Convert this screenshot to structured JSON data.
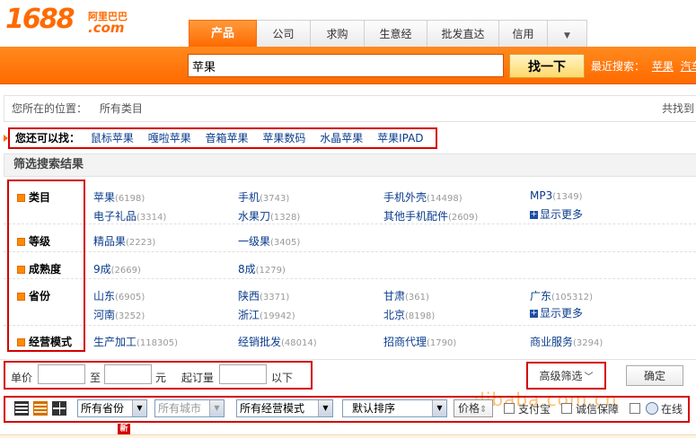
{
  "logo": {
    "number": "1688",
    "brand_cn": "阿里巴巴",
    "domain": ".com"
  },
  "tabs": [
    {
      "label": "产品",
      "active": true
    },
    {
      "label": "公司"
    },
    {
      "label": "求购"
    },
    {
      "label": "生意经"
    },
    {
      "label": "批发直达"
    },
    {
      "label": "信用"
    },
    {
      "label": "▼"
    }
  ],
  "search": {
    "value": "苹果",
    "button": "找一下",
    "recent_label": "最近搜索：",
    "recent": [
      "苹果",
      "汽车"
    ]
  },
  "breadcrumb": {
    "label": "您所在的位置：",
    "current": "所有类目",
    "total": "共找到"
  },
  "also_search": {
    "label": "您还可以找：",
    "items": [
      "鼠标苹果",
      "嘎啦苹果",
      "音箱苹果",
      "苹果数码",
      "水晶苹果",
      "苹果IPAD"
    ]
  },
  "filter": {
    "title": "筛选搜索结果",
    "more_label": "显示更多",
    "rows": [
      {
        "label": "类目",
        "options": [
          {
            "name": "苹果",
            "count": "(6198)"
          },
          {
            "name": "手机",
            "count": "(3743)"
          },
          {
            "name": "手机外壳",
            "count": "(14498)"
          },
          {
            "name": "MP3",
            "count": "(1349)"
          },
          {
            "name": "电子礼品",
            "count": "(3314)"
          },
          {
            "name": "水果刀",
            "count": "(1328)"
          },
          {
            "name": "其他手机配件",
            "count": "(2609)"
          }
        ]
      },
      {
        "label": "等级",
        "options": [
          {
            "name": "精品果",
            "count": "(2223)"
          },
          {
            "name": "一级果",
            "count": "(3405)"
          }
        ]
      },
      {
        "label": "成熟度",
        "options": [
          {
            "name": "9成",
            "count": "(2669)"
          },
          {
            "name": "8成",
            "count": "(1279)"
          }
        ]
      },
      {
        "label": "省份",
        "options": [
          {
            "name": "山东",
            "count": "(6905)"
          },
          {
            "name": "陕西",
            "count": "(3371)"
          },
          {
            "name": "甘肃",
            "count": "(361)"
          },
          {
            "name": "广东",
            "count": "(105312)"
          },
          {
            "name": "河南",
            "count": "(3252)"
          },
          {
            "name": "浙江",
            "count": "(19942)"
          },
          {
            "name": "北京",
            "count": "(8198)"
          }
        ]
      },
      {
        "label": "经营模式",
        "options": [
          {
            "name": "生产加工",
            "count": "(118305)"
          },
          {
            "name": "经销批发",
            "count": "(48014)"
          },
          {
            "name": "招商代理",
            "count": "(1790)"
          },
          {
            "name": "商业服务",
            "count": "(3294)"
          }
        ]
      }
    ]
  },
  "price_filter": {
    "unit_price": "单价",
    "to": "至",
    "yuan": "元",
    "moq": "起订量",
    "below": "以下",
    "advanced": "高级筛选",
    "advanced_arrow": "﹀",
    "confirm": "确定"
  },
  "sortbar": {
    "province": "所有省份",
    "city": "所有城市",
    "biz_mode": "所有经营模式",
    "sort": "默认排序",
    "price": "价格",
    "price_arrow": "⇕",
    "ali_pay": "支付宝",
    "trust": "诚信保障",
    "online": "在线"
  },
  "watermark": "alibaba.com.cn",
  "new_badge": "新",
  "colors": {
    "accent": "#ff6a00",
    "link": "#0a3c8c",
    "highlight_box": "#d40000",
    "count": "#999999"
  }
}
